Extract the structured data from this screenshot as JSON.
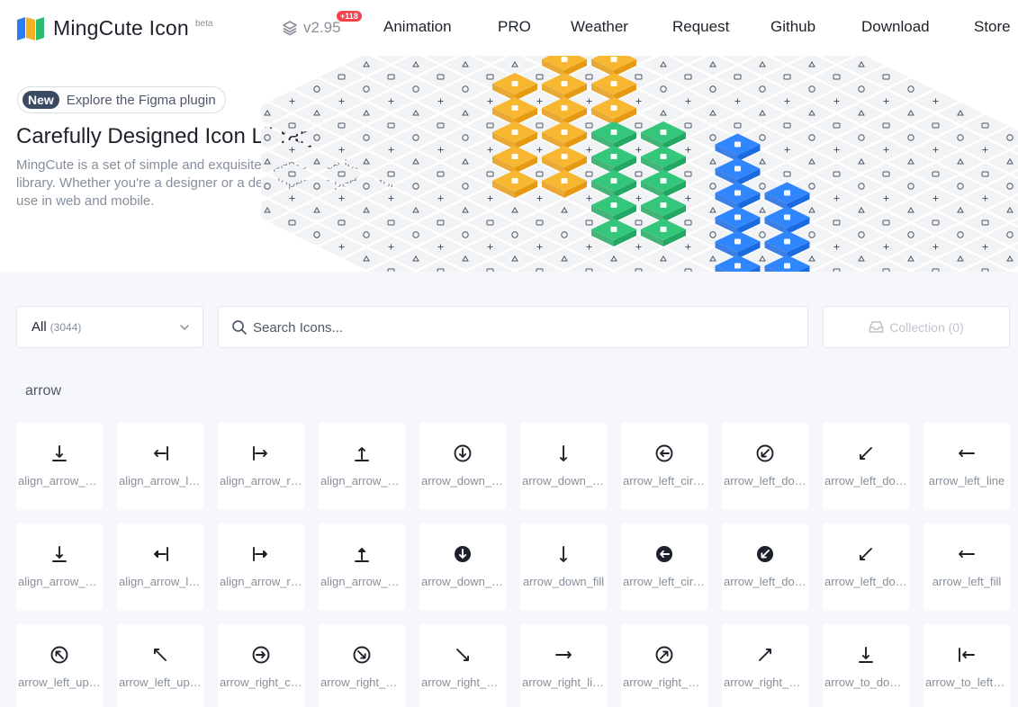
{
  "app": {
    "name": "MingCute Icon",
    "beta": "beta",
    "version": "v2.95",
    "version_badge": "+118",
    "brand_colors": [
      "#2b7cf6",
      "#f4b025",
      "#2bbd6f"
    ]
  },
  "nav": [
    "Animation",
    "PRO",
    "Weather",
    "Request",
    "Github",
    "Download",
    "Store"
  ],
  "hero": {
    "tag": "New",
    "tag_text": "Explore the Figma plugin",
    "title": "Carefully Designed Icon Library",
    "description": "MingCute is a set of simple and exquisite open-source icon library. Whether you're a designer or a developer, it's perfect for use in web and mobile."
  },
  "filter": {
    "selected": "All",
    "count": "(3044)"
  },
  "search": {
    "placeholder": "Search Icons..."
  },
  "collection": {
    "label": "Collection (0)"
  },
  "section": {
    "title": "arrow"
  },
  "icons": [
    {
      "label": "align_arrow_down_line",
      "icon": "align-arrow-down-icon"
    },
    {
      "label": "align_arrow_left_line",
      "icon": "align-arrow-left-icon"
    },
    {
      "label": "align_arrow_right_line",
      "icon": "align-arrow-right-icon"
    },
    {
      "label": "align_arrow_up_line",
      "icon": "align-arrow-up-icon"
    },
    {
      "label": "arrow_down_circle_line",
      "icon": "arrow-down-circle-icon"
    },
    {
      "label": "arrow_down_line",
      "icon": "arrow-down-icon"
    },
    {
      "label": "arrow_left_circle_line",
      "icon": "arrow-left-circle-icon"
    },
    {
      "label": "arrow_left_down_circle_line",
      "icon": "arrow-left-down-circle-icon"
    },
    {
      "label": "arrow_left_down_line",
      "icon": "arrow-left-down-icon"
    },
    {
      "label": "arrow_left_line",
      "icon": "arrow-left-icon"
    },
    {
      "label": "align_arrow_down_fill",
      "icon": "align-arrow-down-icon"
    },
    {
      "label": "align_arrow_left_fill",
      "icon": "align-arrow-left-icon"
    },
    {
      "label": "align_arrow_right_fill",
      "icon": "align-arrow-right-icon"
    },
    {
      "label": "align_arrow_up_fill",
      "icon": "align-arrow-up-icon"
    },
    {
      "label": "arrow_down_circle_fill",
      "icon": "arrow-down-circle-icon"
    },
    {
      "label": "arrow_down_fill",
      "icon": "arrow-down-icon"
    },
    {
      "label": "arrow_left_circle_fill",
      "icon": "arrow-left-circle-icon"
    },
    {
      "label": "arrow_left_down_circle_fill",
      "icon": "arrow-left-down-circle-icon"
    },
    {
      "label": "arrow_left_down_fill",
      "icon": "arrow-left-down-icon"
    },
    {
      "label": "arrow_left_fill",
      "icon": "arrow-left-icon"
    },
    {
      "label": "arrow_left_up_circle_line",
      "icon": "arrow-left-up-circle-icon"
    },
    {
      "label": "arrow_left_up_line",
      "icon": "arrow-left-up-icon"
    },
    {
      "label": "arrow_right_circle_line",
      "icon": "arrow-right-circle-icon"
    },
    {
      "label": "arrow_right_down_circle_line",
      "icon": "arrow-right-down-circle-icon"
    },
    {
      "label": "arrow_right_down_line",
      "icon": "arrow-right-down-icon"
    },
    {
      "label": "arrow_right_line",
      "icon": "arrow-right-icon"
    },
    {
      "label": "arrow_right_up_circle_line",
      "icon": "arrow-right-up-circle-icon"
    },
    {
      "label": "arrow_right_up_line",
      "icon": "arrow-right-up-icon"
    },
    {
      "label": "arrow_to_down_line",
      "icon": "arrow-to-down-icon"
    },
    {
      "label": "arrow_to_left_line",
      "icon": "arrow-to-left-icon"
    }
  ]
}
